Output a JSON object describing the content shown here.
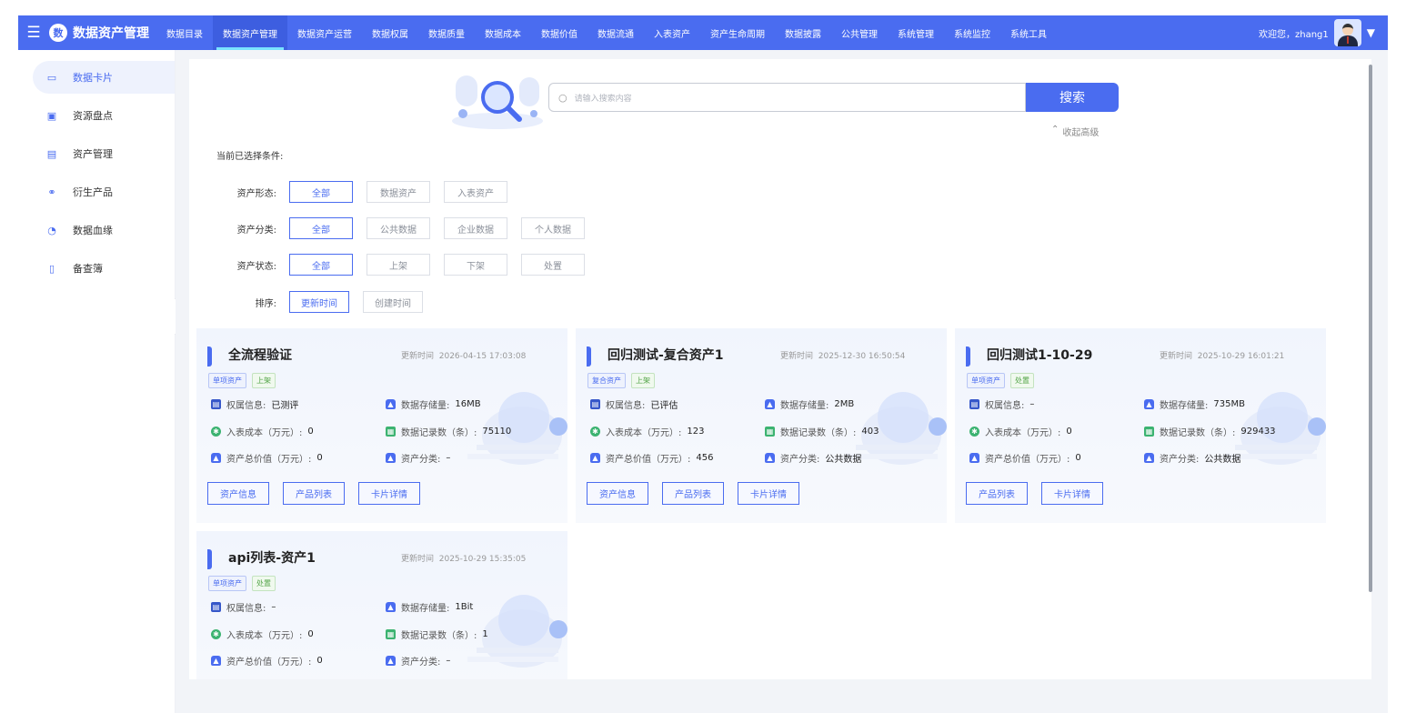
{
  "app": {
    "title": "数据资产管理",
    "logo_char": "数"
  },
  "nav": [
    {
      "label": "数据目录"
    },
    {
      "label": "数据资产管理",
      "active": true
    },
    {
      "label": "数据资产运营"
    },
    {
      "label": "数据权属"
    },
    {
      "label": "数据质量"
    },
    {
      "label": "数据成本"
    },
    {
      "label": "数据价值"
    },
    {
      "label": "数据流通"
    },
    {
      "label": "入表资产"
    },
    {
      "label": "资产生命周期"
    },
    {
      "label": "数据披露"
    },
    {
      "label": "公共管理"
    },
    {
      "label": "系统管理"
    },
    {
      "label": "系统监控"
    },
    {
      "label": "系统工具"
    }
  ],
  "user": {
    "greeting": "欢迎您，zhang1"
  },
  "sidebar": [
    {
      "label": "数据卡片",
      "icon": "card-icon",
      "active": true
    },
    {
      "label": "资源盘点",
      "icon": "inventory-icon"
    },
    {
      "label": "资产管理",
      "icon": "asset-icon"
    },
    {
      "label": "衍生产品",
      "icon": "derivative-icon"
    },
    {
      "label": "数据血缘",
      "icon": "lineage-icon"
    },
    {
      "label": "备查簿",
      "icon": "book-icon"
    }
  ],
  "search": {
    "placeholder": "请输入搜索内容",
    "button": "搜索",
    "advanced_toggle": "收起高级"
  },
  "filters": {
    "current_label": "当前已选择条件:",
    "rows": [
      {
        "label": "资产形态:",
        "options": [
          "全部",
          "数据资产",
          "入表资产"
        ],
        "selected": 0
      },
      {
        "label": "资产分类:",
        "options": [
          "全部",
          "公共数据",
          "企业数据",
          "个人数据"
        ],
        "selected": 0
      },
      {
        "label": "资产状态:",
        "options": [
          "全部",
          "上架",
          "下架",
          "处置"
        ],
        "selected": 0
      },
      {
        "label": "排序:",
        "options": [
          "更新时间",
          "创建时间"
        ],
        "selected": 0
      }
    ]
  },
  "field_labels": {
    "ownership": "权属信息:",
    "storage": "数据存储量:",
    "cost": "入表成本（万元）:",
    "records": "数据记录数（条）:",
    "value": "资产总价值（万元）:",
    "category": "资产分类:"
  },
  "time_label": "更新时间",
  "cards": [
    {
      "title": "全流程验证",
      "time": "2026-04-15 17:03:08",
      "tags": [
        "单项资产",
        "上架"
      ],
      "ownership": "已测评",
      "storage": "16MB",
      "cost": "0",
      "records": "75110",
      "value": "0",
      "category": "–",
      "actions": [
        "资产信息",
        "产品列表",
        "卡片详情"
      ]
    },
    {
      "title": "回归测试-复合资产1",
      "time": "2025-12-30 16:50:54",
      "tags": [
        "复合资产",
        "上架"
      ],
      "ownership": "已评估",
      "storage": "2MB",
      "cost": "123",
      "records": "403",
      "value": "456",
      "category": "公共数据",
      "actions": [
        "资产信息",
        "产品列表",
        "卡片详情"
      ]
    },
    {
      "title": "回归测试1-10-29",
      "time": "2025-10-29 16:01:21",
      "tags": [
        "单项资产",
        "处置"
      ],
      "ownership": "–",
      "storage": "735MB",
      "cost": "0",
      "records": "929433",
      "value": "0",
      "category": "公共数据",
      "actions": [
        "产品列表",
        "卡片详情"
      ]
    },
    {
      "title": "api列表-资产1",
      "time": "2025-10-29 15:35:05",
      "tags": [
        "单项资产",
        "处置"
      ],
      "ownership": "–",
      "storage": "1Bit",
      "cost": "0",
      "records": "1",
      "value": "0",
      "category": "–",
      "actions": []
    }
  ],
  "colors": {
    "primary": "#4a6cf0",
    "success": "#52a447",
    "background": "#f2f4f8"
  }
}
